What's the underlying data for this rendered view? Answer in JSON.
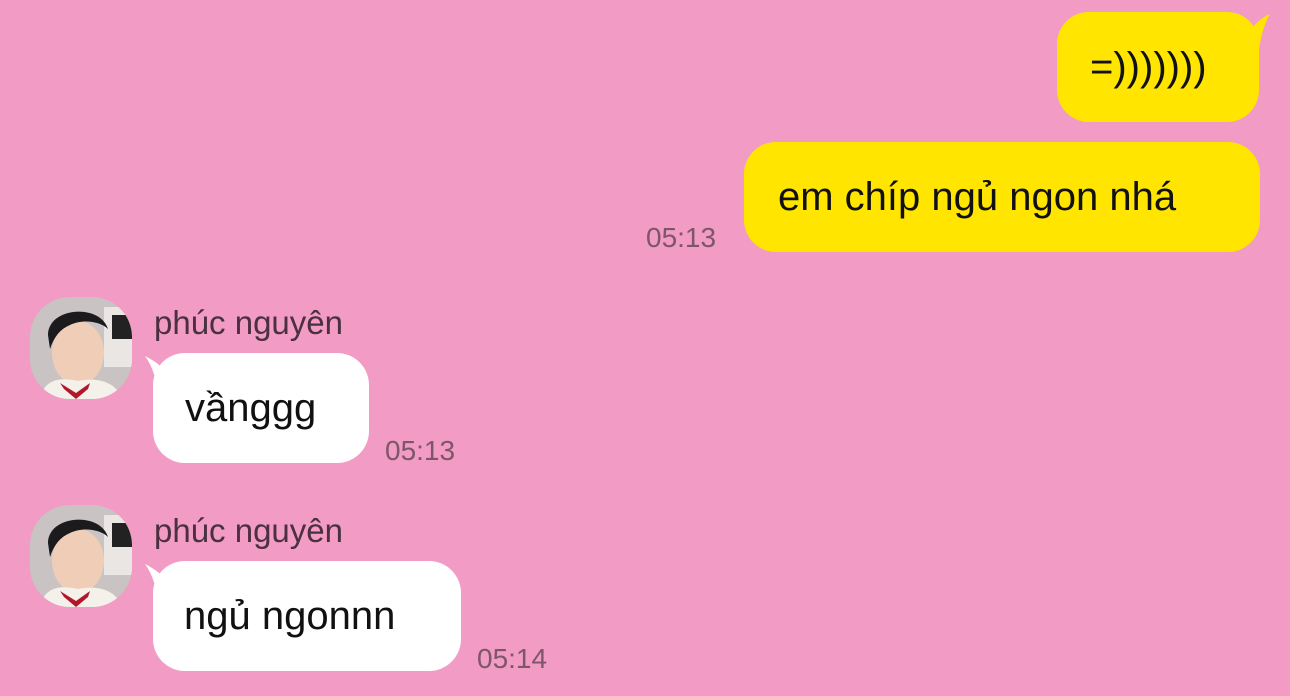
{
  "messages": [
    {
      "sender": "me",
      "text": "=)))))))",
      "time": ""
    },
    {
      "sender": "me",
      "text": "em chíp ngủ ngon nhá",
      "time": "05:13"
    },
    {
      "sender": "phúc nguyên",
      "text": "vầnggg",
      "time": "05:13"
    },
    {
      "sender": "phúc nguyên",
      "text": "ngủ ngonnn",
      "time": "05:14"
    }
  ],
  "colors": {
    "background": "#f29bc4",
    "my_bubble": "#ffe500",
    "their_bubble": "#ffffff"
  }
}
